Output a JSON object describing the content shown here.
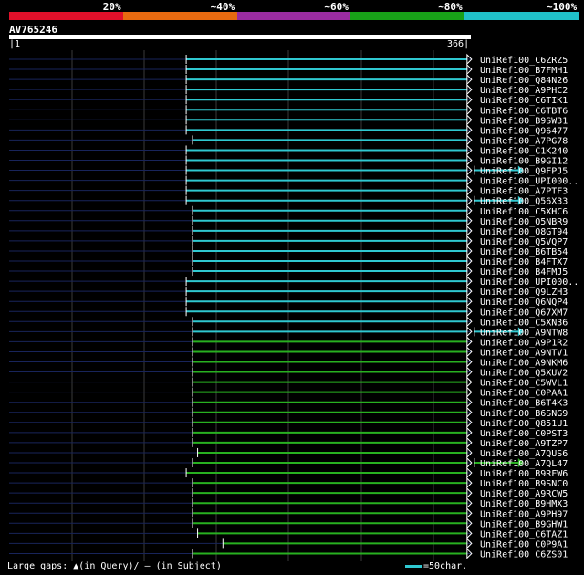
{
  "legend": {
    "labels": [
      "20%",
      "~40%",
      "~60%",
      "~80%",
      "~100%"
    ],
    "colors": [
      "#e0102a",
      "#e86a10",
      "#9a2ca0",
      "#18a018",
      "#20c0c8"
    ]
  },
  "query": {
    "name": "AV765246",
    "start": "1",
    "end": "366"
  },
  "colors": {
    "high": "#2fc8d0",
    "mid": "#28b020",
    "track": "#18245a",
    "grid": "#3a3a3a"
  },
  "hits": [
    {
      "name": "UniRef100_C6ZRZ5",
      "start": 141,
      "end": 363,
      "color": "high",
      "ext": false
    },
    {
      "name": "UniRef100_B7FMH1",
      "start": 141,
      "end": 363,
      "color": "high",
      "ext": false
    },
    {
      "name": "UniRef100_Q84N26",
      "start": 141,
      "end": 363,
      "color": "high",
      "ext": false
    },
    {
      "name": "UniRef100_A9PHC2",
      "start": 141,
      "end": 363,
      "color": "high",
      "ext": false
    },
    {
      "name": "UniRef100_C6TIK1",
      "start": 141,
      "end": 363,
      "color": "high",
      "ext": false
    },
    {
      "name": "UniRef100_C6TBT6",
      "start": 141,
      "end": 363,
      "color": "high",
      "ext": false
    },
    {
      "name": "UniRef100_B9SW31",
      "start": 141,
      "end": 363,
      "color": "high",
      "ext": false
    },
    {
      "name": "UniRef100_Q96477",
      "start": 141,
      "end": 363,
      "color": "high",
      "ext": false
    },
    {
      "name": "UniRef100_A7PG78",
      "start": 146,
      "end": 363,
      "color": "high",
      "ext": false
    },
    {
      "name": "UniRef100_C1K240",
      "start": 141,
      "end": 363,
      "color": "high",
      "ext": false
    },
    {
      "name": "UniRef100_B9GI12",
      "start": 141,
      "end": 363,
      "color": "high",
      "ext": false
    },
    {
      "name": "UniRef100_Q9FPJ5",
      "start": 141,
      "end": 363,
      "color": "high",
      "ext": true
    },
    {
      "name": "UniRef100_UPI000..",
      "start": 141,
      "end": 363,
      "color": "high",
      "ext": false
    },
    {
      "name": "UniRef100_A7PTF3",
      "start": 141,
      "end": 363,
      "color": "high",
      "ext": false
    },
    {
      "name": "UniRef100_Q56X33",
      "start": 141,
      "end": 363,
      "color": "high",
      "ext": true
    },
    {
      "name": "UniRef100_C5XHC6",
      "start": 146,
      "end": 363,
      "color": "high",
      "ext": false
    },
    {
      "name": "UniRef100_Q5NBR9",
      "start": 146,
      "end": 363,
      "color": "high",
      "ext": false
    },
    {
      "name": "UniRef100_Q8GT94",
      "start": 146,
      "end": 363,
      "color": "high",
      "ext": false
    },
    {
      "name": "UniRef100_Q5VQP7",
      "start": 146,
      "end": 363,
      "color": "high",
      "ext": false
    },
    {
      "name": "UniRef100_B6TB54",
      "start": 146,
      "end": 363,
      "color": "high",
      "ext": false
    },
    {
      "name": "UniRef100_B4FTX7",
      "start": 146,
      "end": 363,
      "color": "high",
      "ext": false
    },
    {
      "name": "UniRef100_B4FMJ5",
      "start": 146,
      "end": 363,
      "color": "high",
      "ext": false
    },
    {
      "name": "UniRef100_UPI000..",
      "start": 141,
      "end": 363,
      "color": "high",
      "ext": false
    },
    {
      "name": "UniRef100_Q9LZH3",
      "start": 141,
      "end": 363,
      "color": "high",
      "ext": false
    },
    {
      "name": "UniRef100_Q6NQP4",
      "start": 141,
      "end": 363,
      "color": "high",
      "ext": false
    },
    {
      "name": "UniRef100_Q67XM7",
      "start": 141,
      "end": 363,
      "color": "high",
      "ext": false
    },
    {
      "name": "UniRef100_C5XN36",
      "start": 146,
      "end": 363,
      "color": "high",
      "ext": false
    },
    {
      "name": "UniRef100_A9NTW8",
      "start": 146,
      "end": 363,
      "color": "high",
      "ext": true
    },
    {
      "name": "UniRef100_A9P1R2",
      "start": 146,
      "end": 363,
      "color": "mid",
      "ext": false
    },
    {
      "name": "UniRef100_A9NTV1",
      "start": 146,
      "end": 363,
      "color": "mid",
      "ext": false
    },
    {
      "name": "UniRef100_A9NKM6",
      "start": 146,
      "end": 363,
      "color": "mid",
      "ext": false
    },
    {
      "name": "UniRef100_Q5XUV2",
      "start": 146,
      "end": 363,
      "color": "mid",
      "ext": false
    },
    {
      "name": "UniRef100_C5WVL1",
      "start": 146,
      "end": 363,
      "color": "mid",
      "ext": false
    },
    {
      "name": "UniRef100_C0PAA1",
      "start": 146,
      "end": 363,
      "color": "mid",
      "ext": false
    },
    {
      "name": "UniRef100_B6T4K3",
      "start": 146,
      "end": 363,
      "color": "mid",
      "ext": false
    },
    {
      "name": "UniRef100_B6SNG9",
      "start": 146,
      "end": 363,
      "color": "mid",
      "ext": false
    },
    {
      "name": "UniRef100_Q851U1",
      "start": 146,
      "end": 363,
      "color": "mid",
      "ext": false
    },
    {
      "name": "UniRef100_C0PST3",
      "start": 146,
      "end": 363,
      "color": "mid",
      "ext": false
    },
    {
      "name": "UniRef100_A9TZP7",
      "start": 146,
      "end": 363,
      "color": "mid",
      "ext": false
    },
    {
      "name": "UniRef100_A7QUS6",
      "start": 150,
      "end": 363,
      "color": "mid",
      "ext": false
    },
    {
      "name": "UniRef100_A7QL47",
      "start": 146,
      "end": 363,
      "color": "mid",
      "ext": true
    },
    {
      "name": "UniRef100_B9RFW6",
      "start": 141,
      "end": 363,
      "color": "mid",
      "ext": false
    },
    {
      "name": "UniRef100_B9SNC0",
      "start": 146,
      "end": 363,
      "color": "mid",
      "ext": false
    },
    {
      "name": "UniRef100_A9RCW5",
      "start": 146,
      "end": 363,
      "color": "mid",
      "ext": false
    },
    {
      "name": "UniRef100_B9HMX3",
      "start": 146,
      "end": 363,
      "color": "mid",
      "ext": false
    },
    {
      "name": "UniRef100_A9PH97",
      "start": 146,
      "end": 363,
      "color": "mid",
      "ext": false
    },
    {
      "name": "UniRef100_B9GHW1",
      "start": 146,
      "end": 363,
      "color": "mid",
      "ext": false
    },
    {
      "name": "UniRef100_C6TAZ1",
      "start": 150,
      "end": 363,
      "color": "mid",
      "ext": false
    },
    {
      "name": "UniRef100_C0P9A1",
      "start": 170,
      "end": 363,
      "color": "mid",
      "ext": false
    },
    {
      "name": "UniRef100_C6ZS01",
      "start": 146,
      "end": 363,
      "color": "mid",
      "ext": false
    }
  ],
  "footer": {
    "gaps_label": "Large gaps:",
    "query_gap": "▲(in Query)/",
    "subject_gap": "‒ (in Subject)"
  },
  "scale": {
    "label": "=50char."
  }
}
